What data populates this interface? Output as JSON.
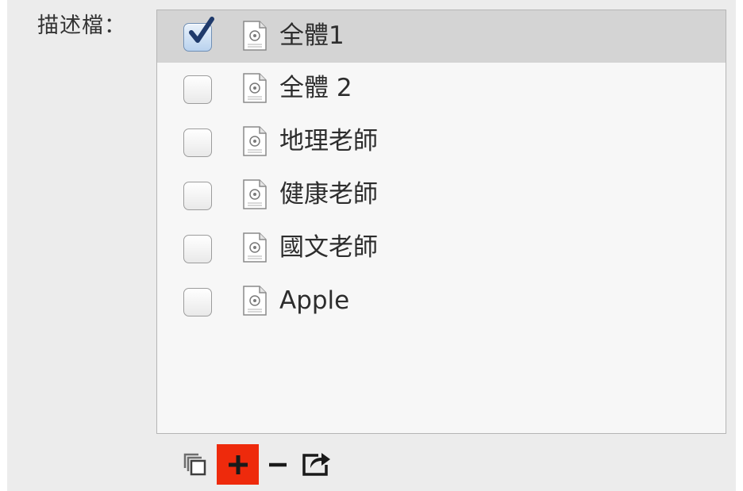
{
  "profiles": {
    "label": "描述檔：",
    "items": [
      {
        "name": "全體1",
        "checked": true,
        "selected": true
      },
      {
        "name": "全體 2",
        "checked": false,
        "selected": false
      },
      {
        "name": "地理老師",
        "checked": false,
        "selected": false
      },
      {
        "name": "健康老師",
        "checked": false,
        "selected": false
      },
      {
        "name": "國文老師",
        "checked": false,
        "selected": false
      },
      {
        "name": "Apple",
        "checked": false,
        "selected": false
      }
    ]
  },
  "toolbar": {
    "buttons": [
      {
        "id": "duplicate",
        "icon": "duplicate-icon"
      },
      {
        "id": "add",
        "icon": "plus-icon",
        "highlighted": true,
        "highlight_color": "#ee2a0c"
      },
      {
        "id": "remove",
        "icon": "minus-icon"
      },
      {
        "id": "export",
        "icon": "share-icon"
      }
    ]
  },
  "colors": {
    "selected_row": "#d4d4d4",
    "list_background": "#f7f7f7",
    "panel_background": "#ececec",
    "checkmark": "#1f3a6b"
  }
}
